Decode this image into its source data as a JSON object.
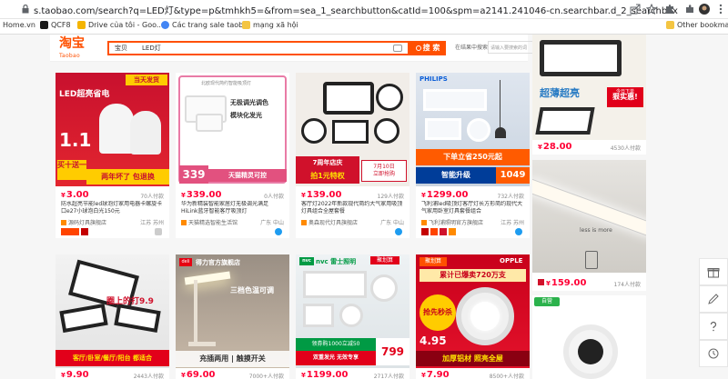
{
  "browser": {
    "url": "s.taobao.com/search?q=LED灯&type=p&tmhkh5=&from=sea_1_searchbutton&catId=100&spm=a2141.241046-cn.searchbar.d_2_searchbox"
  },
  "bookmarks": [
    {
      "label": "Home.vn",
      "color": "#ffffff"
    },
    {
      "label": "QCF8",
      "color": "#1a1a1a"
    },
    {
      "label": "Drive của tôi - Goo...",
      "color": "#f4b400"
    },
    {
      "label": "Các trang sale taob...",
      "color": "#4285f4"
    },
    {
      "label": "mạng xã hội",
      "color": "#f4c542"
    }
  ],
  "bookmarks_other": "Other bookmarks",
  "search": {
    "logo_main": "淘宝",
    "logo_sub": "Taobao",
    "category": "宝贝",
    "query": "LED灯",
    "button_label": "搜 索",
    "sub_label": "在结果中搜索",
    "sub_placeholder": "请输入要搜索的词",
    "sub_button": "确定"
  },
  "products": [
    {
      "price": "3.00",
      "sales": "70人付款",
      "title": "防水超亮节能led球泡灯家用电器卡螺旋卡口e27小球泡白光150元",
      "shop": "源码灯具旗舰店",
      "loc": "江苏 苏州",
      "img": {
        "top": "当天发货",
        "main": "LED超亮省电",
        "sub": "买十送一",
        "tag": "两年坏了 包退换"
      }
    },
    {
      "price": "339.00",
      "sales": "0人付款",
      "title": "华为新精装智能家居灯无极调光满足HiLink蓝牙智能客厅吸顶灯",
      "shop": "天猫精选智能生活馆",
      "loc": "广东 中山",
      "img": {
        "main": "无极调光调色",
        "sub": "模块化发光",
        "tag": "天猫精灵可控",
        "top": "北欧现代简约智能吸顶灯",
        "price": "339"
      }
    },
    {
      "price": "139.00",
      "sales": "129人付款",
      "title": "客厅灯2022年新款现代简约大气家用吸顶灯具组合全屋套餐",
      "shop": "奥森现代灯具旗舰店",
      "loc": "广东 中山",
      "img": {
        "main": "7周年店庆",
        "sub": "拍1元特权",
        "tag": "立即抢购",
        "top": "7月10日"
      }
    },
    {
      "price": "1299.00",
      "sales": "732人付款",
      "title": "飞利浦led吸顶灯客厅灯长方形简约现代大气家用卧室灯具套餐组合",
      "shop": "飞利浦照明官方旗舰店",
      "loc": "江苏 苏州",
      "img": {
        "brand": "PHILIPS",
        "main": "下单立省250元起",
        "sub": "智能升级",
        "price": "1049"
      }
    },
    {
      "price": "28.00",
      "sales": "4530人付款",
      "title": "",
      "shop": "",
      "loc": "",
      "img": {
        "main": "超薄超亮",
        "sub": "狠实惠!",
        "top": "今日下单"
      }
    },
    {
      "price": "159.00",
      "sales": "174人付款",
      "title": "",
      "shop": "",
      "loc": "",
      "img": {
        "main": "less is more"
      }
    },
    {
      "price": "9.90",
      "sales": "2443人付款",
      "title": "",
      "shop": "",
      "loc": "",
      "img": {
        "main": "客厅/卧室/餐厅/阳台 都适合",
        "tag": "圈上的打9.9"
      }
    },
    {
      "price": "69.00",
      "sales": "7000+人付款",
      "title": "",
      "shop": "",
      "loc": "",
      "img": {
        "brand": "得力官方旗舰店",
        "main": "三档色温可调",
        "sub": "充插两用 | 触摸开关"
      }
    },
    {
      "price": "1199.00",
      "sales": "2717人付款",
      "title": "",
      "shop": "",
      "loc": "",
      "img": {
        "brand": "nvc 雷士照明",
        "top": "聚划算",
        "main": "领券购1000立减50",
        "sub": "双重发光 无效专享",
        "price": "799"
      }
    },
    {
      "price": "7.90",
      "sales": "8500+人付款",
      "title": "",
      "shop": "",
      "loc": "",
      "img": {
        "brand": "OPPLE",
        "top": "聚划算",
        "main": "累计已爆卖720万支",
        "sub": "抢先秒杀",
        "tag": "加厚铝材 照亮全屋",
        "price": "4.95"
      }
    },
    {
      "price": "",
      "sales": "",
      "title": "",
      "shop": "",
      "loc": "",
      "img": {
        "tag": "自营"
      }
    }
  ],
  "side_panel": [
    {
      "icon": "gift-icon"
    },
    {
      "icon": "edit-icon"
    },
    {
      "icon": "help-icon"
    },
    {
      "icon": "history-icon"
    }
  ]
}
